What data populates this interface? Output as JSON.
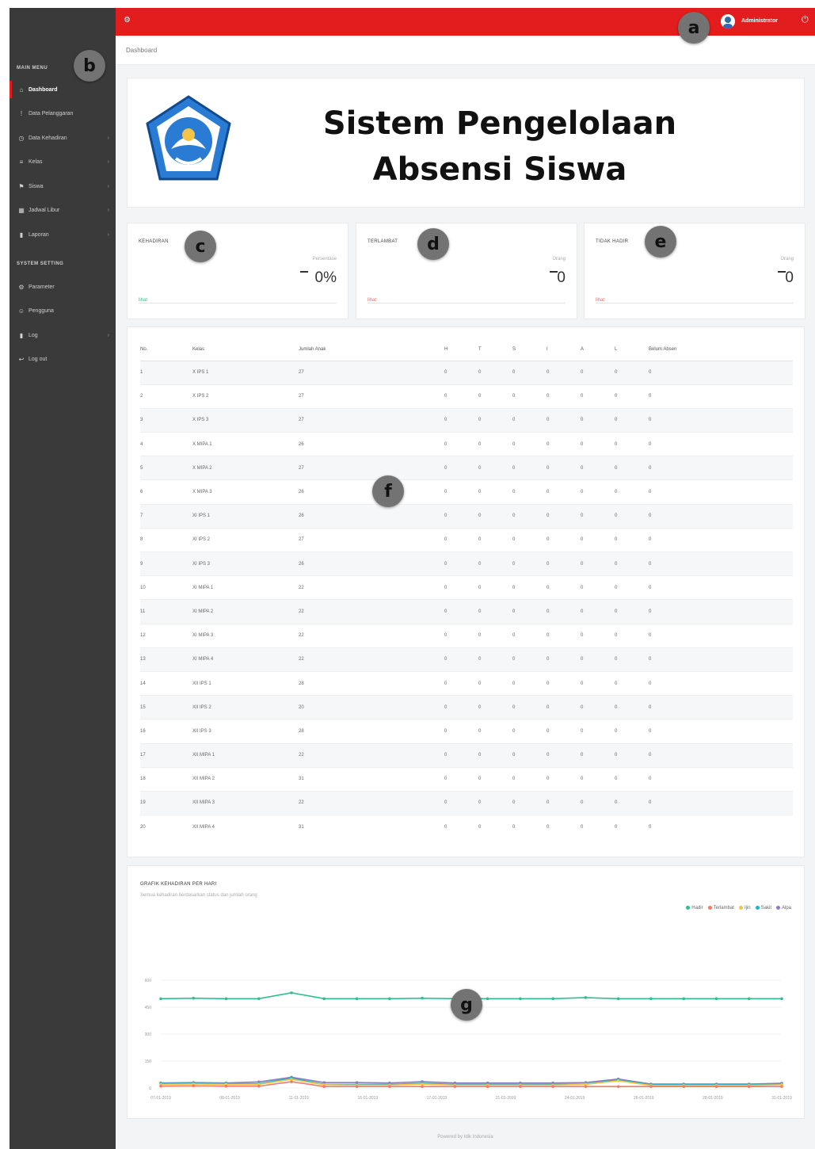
{
  "topbar": {
    "username": "Administrator"
  },
  "breadcrumb": {
    "current": "Dashboard"
  },
  "markers": {
    "a": "a",
    "b": "b",
    "c": "c",
    "d": "d",
    "e": "e",
    "f": "f",
    "g": "g"
  },
  "sidebar": {
    "main_heading": "MAIN MENU",
    "items": [
      {
        "label": "Dashboard",
        "icon": "home-icon"
      },
      {
        "label": "Data Pelanggaran",
        "icon": "warning-icon"
      },
      {
        "label": "Data Kehadiran",
        "icon": "clock-icon"
      },
      {
        "label": "Kelas",
        "icon": "list-icon"
      },
      {
        "label": "Siswa",
        "icon": "flag-icon"
      },
      {
        "label": "Jadwal Libur",
        "icon": "calendar-icon"
      },
      {
        "label": "Laporan",
        "icon": "chart-icon"
      }
    ],
    "settings_heading": "SYSTEM SETTING",
    "settings_items": [
      {
        "label": "Parameter",
        "icon": "gear-icon"
      },
      {
        "label": "Pengguna",
        "icon": "user-icon"
      },
      {
        "label": "Log",
        "icon": "chart-icon"
      },
      {
        "label": "Log out",
        "icon": "logout-icon"
      }
    ]
  },
  "banner": {
    "title_line1": "Sistem Pengelolaan",
    "title_line2": "Absensi Siswa",
    "logo_text": "TUT WURI HANDAYANI"
  },
  "stats": [
    {
      "title": "KEHADIRAN",
      "unit": "Persentase",
      "value": "0%",
      "link": "lihat",
      "color": "#2ebf91"
    },
    {
      "title": "TERLAMBAT",
      "unit": "Orang",
      "value": "0",
      "link": "lihat",
      "color": "#e36b6b"
    },
    {
      "title": "TIDAK HADIR",
      "unit": "Orang",
      "value": "0",
      "link": "lihat",
      "color": "#e36b6b"
    }
  ],
  "table": {
    "headers": [
      "No.",
      "Kelas",
      "Jumlah Anak",
      "H",
      "T",
      "S",
      "I",
      "A",
      "L",
      "Belum Absen"
    ],
    "rows": [
      [
        "1",
        "X IPS 1",
        "27",
        "0",
        "0",
        "0",
        "0",
        "0",
        "0",
        "0"
      ],
      [
        "2",
        "X IPS 2",
        "27",
        "0",
        "0",
        "0",
        "0",
        "0",
        "0",
        "0"
      ],
      [
        "3",
        "X IPS 3",
        "27",
        "0",
        "0",
        "0",
        "0",
        "0",
        "0",
        "0"
      ],
      [
        "4",
        "X MIPA 1",
        "26",
        "0",
        "0",
        "0",
        "0",
        "0",
        "0",
        "0"
      ],
      [
        "5",
        "X MIPA 2",
        "27",
        "0",
        "0",
        "0",
        "0",
        "0",
        "0",
        "0"
      ],
      [
        "6",
        "X MIPA 3",
        "26",
        "0",
        "0",
        "0",
        "0",
        "0",
        "0",
        "0"
      ],
      [
        "7",
        "XI IPS 1",
        "26",
        "0",
        "0",
        "0",
        "0",
        "0",
        "0",
        "0"
      ],
      [
        "8",
        "XI IPS 2",
        "27",
        "0",
        "0",
        "0",
        "0",
        "0",
        "0",
        "0"
      ],
      [
        "9",
        "XI IPS 3",
        "26",
        "0",
        "0",
        "0",
        "0",
        "0",
        "0",
        "0"
      ],
      [
        "10",
        "XI MIPA 1",
        "22",
        "0",
        "0",
        "0",
        "0",
        "0",
        "0",
        "0"
      ],
      [
        "11",
        "XI MIPA 2",
        "22",
        "0",
        "0",
        "0",
        "0",
        "0",
        "0",
        "0"
      ],
      [
        "12",
        "XI MIPA 3",
        "22",
        "0",
        "0",
        "0",
        "0",
        "0",
        "0",
        "0"
      ],
      [
        "13",
        "XI MIPA 4",
        "22",
        "0",
        "0",
        "0",
        "0",
        "0",
        "0",
        "0"
      ],
      [
        "14",
        "XII IPS 1",
        "28",
        "0",
        "0",
        "0",
        "0",
        "0",
        "0",
        "0"
      ],
      [
        "15",
        "XII IPS 2",
        "20",
        "0",
        "0",
        "0",
        "0",
        "0",
        "0",
        "0"
      ],
      [
        "16",
        "XII IPS 3",
        "28",
        "0",
        "0",
        "0",
        "0",
        "0",
        "0",
        "0"
      ],
      [
        "17",
        "XII MIPA 1",
        "22",
        "0",
        "0",
        "0",
        "0",
        "0",
        "0",
        "0"
      ],
      [
        "18",
        "XII MIPA 2",
        "31",
        "0",
        "0",
        "0",
        "0",
        "0",
        "0",
        "0"
      ],
      [
        "19",
        "XII MIPA 3",
        "22",
        "0",
        "0",
        "0",
        "0",
        "0",
        "0",
        "0"
      ],
      [
        "20",
        "XII MIPA 4",
        "31",
        "0",
        "0",
        "0",
        "0",
        "0",
        "0",
        "0"
      ]
    ]
  },
  "chart": {
    "title": "GRAFIK KEHADIRAN PER HARI",
    "subtitle": "Semua kehadiran berdasarkan status dan jumlah orang"
  },
  "chart_data": {
    "type": "line",
    "ylim": [
      0,
      900
    ],
    "yticks": [
      "0",
      "150",
      "300",
      "450",
      "600"
    ],
    "xticks": [
      "07-01-2019",
      "08-01-2019",
      "11-01-2019",
      "16-01-2019",
      "17-01-2019",
      "21-01-2019",
      "24-01-2019",
      "26-01-2019",
      "28-01-2019",
      "31-01-2019"
    ],
    "points": 20,
    "series": [
      {
        "name": "Hadir",
        "color": "#2ebf91",
        "values": [
          497,
          500,
          497,
          497,
          530,
          497,
          497,
          497,
          500,
          497,
          497,
          497,
          497,
          503,
          497,
          497,
          497,
          497,
          497,
          497
        ]
      },
      {
        "name": "Terlambat",
        "color": "#f27a6a",
        "values": [
          10,
          12,
          10,
          10,
          35,
          8,
          8,
          8,
          8,
          8,
          8,
          8,
          8,
          8,
          8,
          8,
          8,
          8,
          8,
          8
        ]
      },
      {
        "name": "Ijin",
        "color": "#f5c445",
        "values": [
          20,
          22,
          20,
          20,
          48,
          18,
          16,
          16,
          22,
          16,
          16,
          16,
          16,
          20,
          40,
          14,
          14,
          14,
          14,
          18
        ]
      },
      {
        "name": "Sakit",
        "color": "#1fb5c9",
        "values": [
          25,
          26,
          24,
          24,
          55,
          20,
          20,
          20,
          26,
          20,
          20,
          20,
          20,
          22,
          45,
          18,
          18,
          18,
          18,
          22
        ]
      },
      {
        "name": "Alpa",
        "color": "#8e7cc3",
        "values": [
          28,
          30,
          28,
          34,
          60,
          30,
          30,
          28,
          35,
          28,
          28,
          28,
          28,
          30,
          50,
          22,
          22,
          22,
          22,
          26
        ]
      }
    ]
  },
  "footer": {
    "text": "Powered by Idik Indonesia"
  }
}
